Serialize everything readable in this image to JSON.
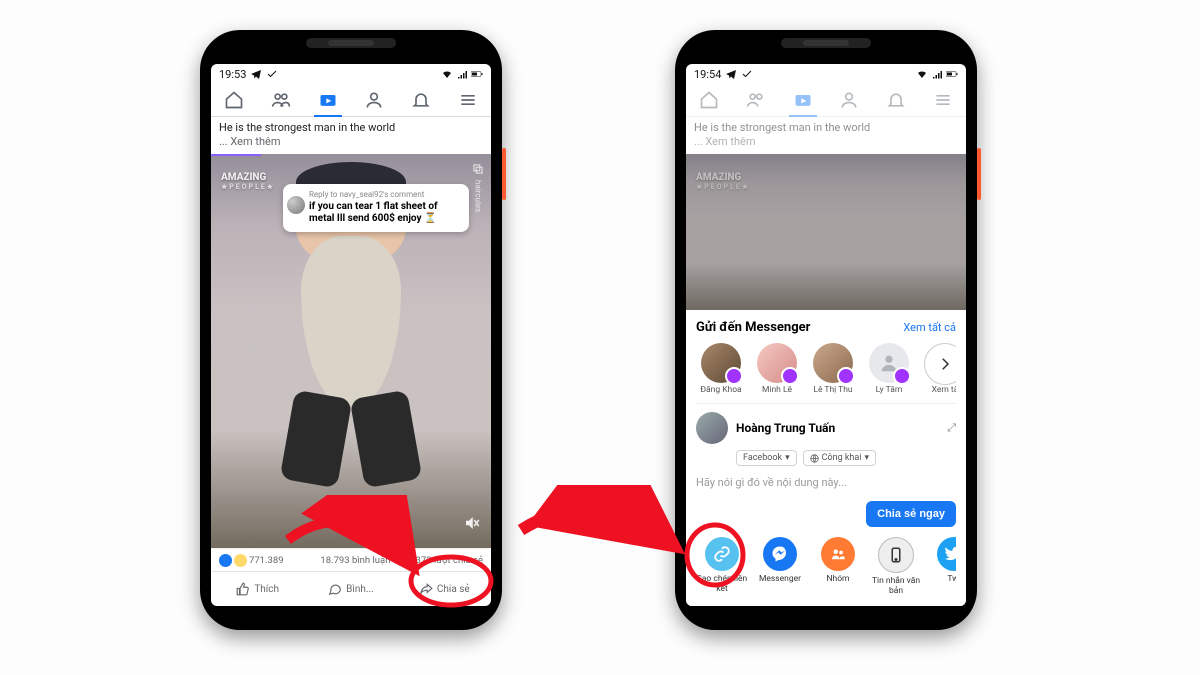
{
  "phone1": {
    "status_time": "19:53",
    "caption_line1": "He is the strongest man in the world",
    "caption_line2": "... Xem thêm",
    "watermark": "AMAZING",
    "watermark_sub": "★PEOPLE★",
    "side_tag": "haircules",
    "bubble_reply_to": "Reply to navy_seal92's comment",
    "bubble_text": "if you can tear 1 flat sheet of metal Ill send 600$ enjoy ⏳",
    "reactions_count": "771.389",
    "comments": "18.793 bình luận",
    "shares": "59.373 lượt chia sẻ",
    "btn_like": "Thích",
    "btn_comment": "Bình...",
    "btn_share": "Chia sẻ"
  },
  "phone2": {
    "status_time": "19:54",
    "caption_line1": "He is the strongest man in the world",
    "caption_line2": "... Xem thêm",
    "sheet_title": "Gửi đến Messenger",
    "see_all": "Xem tất cả",
    "contacts": [
      {
        "name": "Đăng Khoa"
      },
      {
        "name": "Minh Lê"
      },
      {
        "name": "Lê Thị Thu"
      },
      {
        "name": "Ly Tâm"
      },
      {
        "name": "Xem tấ"
      }
    ],
    "compose_user": "Hoàng Trung Tuấn",
    "chip_feed": "Facebook",
    "chip_privacy": "Công khai",
    "compose_placeholder": "Hãy nói gì đó về nội dung này...",
    "share_now": "Chia sẻ ngay",
    "targets": [
      {
        "label": "Sao chép liên kết"
      },
      {
        "label": "Messenger"
      },
      {
        "label": "Nhóm"
      },
      {
        "label": "Tin nhắn văn bản"
      },
      {
        "label": "Twi"
      }
    ]
  }
}
